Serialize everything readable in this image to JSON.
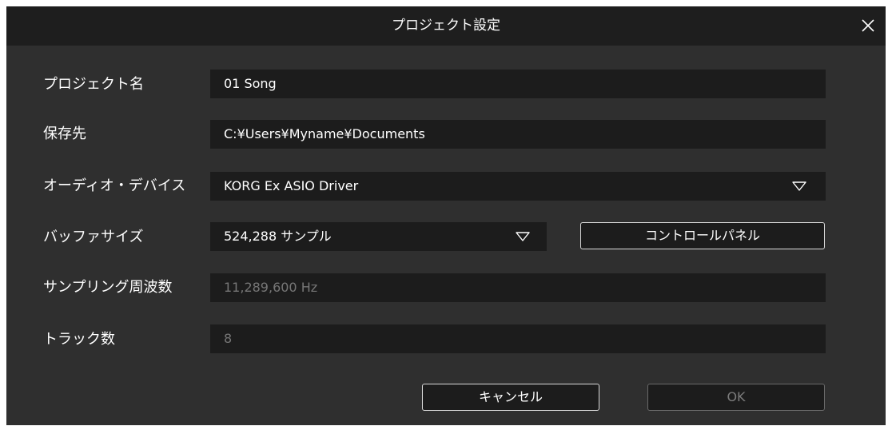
{
  "dialog": {
    "title": "プロジェクト設定",
    "close_icon": "close-icon"
  },
  "fields": {
    "project_name": {
      "label": "プロジェクト名",
      "value": "01 Song"
    },
    "save_location": {
      "label": "保存先",
      "value": "C:¥Users¥Myname¥Documents"
    },
    "audio_device": {
      "label": "オーディオ・デバイス",
      "value": "KORG Ex ASIO Driver",
      "icon": "dropdown-triangle-icon"
    },
    "buffer_size": {
      "label": "バッファサイズ",
      "value": "524,288 サンプル",
      "icon": "dropdown-triangle-icon"
    },
    "sample_rate": {
      "label": "サンプリング周波数",
      "value": "11,289,600 Hz",
      "disabled": true
    },
    "track_count": {
      "label": "トラック数",
      "value": "8",
      "disabled": true
    }
  },
  "buttons": {
    "control_panel": "コントロールパネル",
    "cancel": "キャンセル",
    "ok": "OK",
    "ok_disabled": true
  }
}
